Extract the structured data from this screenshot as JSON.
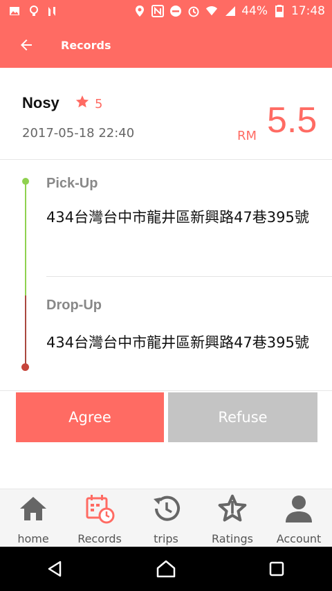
{
  "status_bar": {
    "battery": "44%",
    "time": "17:48",
    "icons": [
      "image-icon",
      "bulb-icon",
      "n-icon",
      "location-icon",
      "nfc-icon",
      "do-not-disturb-icon",
      "alarm-icon",
      "wifi-icon",
      "signal-icon",
      "battery-icon"
    ]
  },
  "app_bar": {
    "title": "Records",
    "back_icon": "arrow-left-icon"
  },
  "record": {
    "name": "Nosy",
    "rating": "5",
    "datetime": "2017-05-18 22:40",
    "currency": "RM",
    "amount": "5.5"
  },
  "route": {
    "pickup_label": "Pick-Up",
    "pickup_address": "434台灣台中市龍井區新興路47巷395號",
    "dropoff_label": "Drop-Up",
    "dropoff_address": "434台灣台中市龍井區新興路47巷395號"
  },
  "actions": {
    "agree": "Agree",
    "refuse": "Refuse"
  },
  "bottom_nav": [
    {
      "label": "home",
      "icon": "home-icon"
    },
    {
      "label": "Records",
      "icon": "calendar-clock-icon",
      "active": true
    },
    {
      "label": "trips",
      "icon": "history-icon"
    },
    {
      "label": "Ratings",
      "icon": "star-icon"
    },
    {
      "label": "Account",
      "icon": "person-icon"
    }
  ],
  "colors": {
    "accent": "#ff6b63",
    "green": "#8fd14f",
    "red": "#c6453b",
    "inactive": "#c4c4c4"
  }
}
